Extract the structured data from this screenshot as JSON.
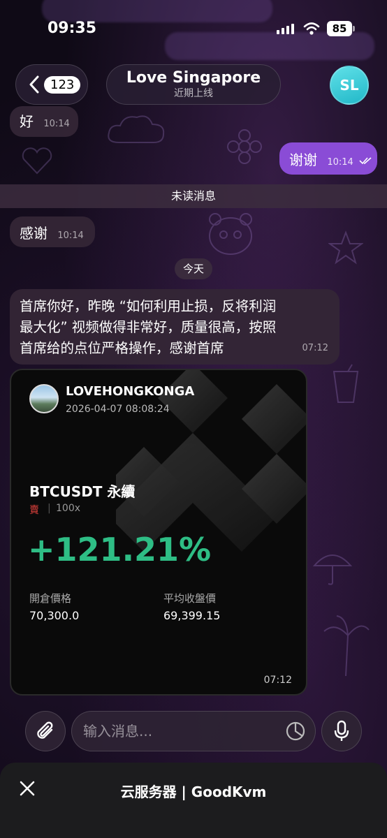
{
  "status_bar": {
    "time": "09:35",
    "battery": "85"
  },
  "header": {
    "back_count": "123",
    "title": "Love Singapore",
    "subtitle": "近期上线",
    "avatar_initials": "SL"
  },
  "messages": [
    {
      "direction": "in",
      "text": "好",
      "time": "10:14"
    },
    {
      "direction": "out",
      "text": "谢谢",
      "time": "10:14",
      "status": "read"
    },
    {
      "direction": "in",
      "text": "感谢",
      "time": "10:14"
    },
    {
      "direction": "in",
      "lines": [
        "首席你好，昨晚 “如何利用止损，反将利润",
        "最大化” 视频做得非常好，质量很高，按照",
        "首席给的点位严格操作，感谢首席"
      ],
      "time": "07:12"
    }
  ],
  "unread_divider": "未读消息",
  "date_divider": "今天",
  "trade_card": {
    "username": "LOVEHONGKONGA",
    "datetime": "2026-04-07 08:08:24",
    "pair": "BTCUSDT 永續",
    "side": "賣",
    "separator": "|",
    "leverage": "100x",
    "pnl": "+121.21%",
    "entry_label": "開倉價格",
    "entry_value": "70,300.0",
    "exit_label": "平均收盤價",
    "exit_value": "69,399.15",
    "time": "07:12"
  },
  "composer": {
    "placeholder": "输入消息..."
  },
  "bottom_sheet": {
    "title": "云服务器 | GoodKvm"
  },
  "colors": {
    "outgoing": "#8a4cd6",
    "profit": "#2ebd85",
    "sell": "#e0413c",
    "avatar": "#3cc8d6"
  },
  "icons": [
    "back-chevron-icon",
    "read-check-icon",
    "paperclip-icon",
    "sticker-icon",
    "microphone-icon",
    "close-icon"
  ]
}
